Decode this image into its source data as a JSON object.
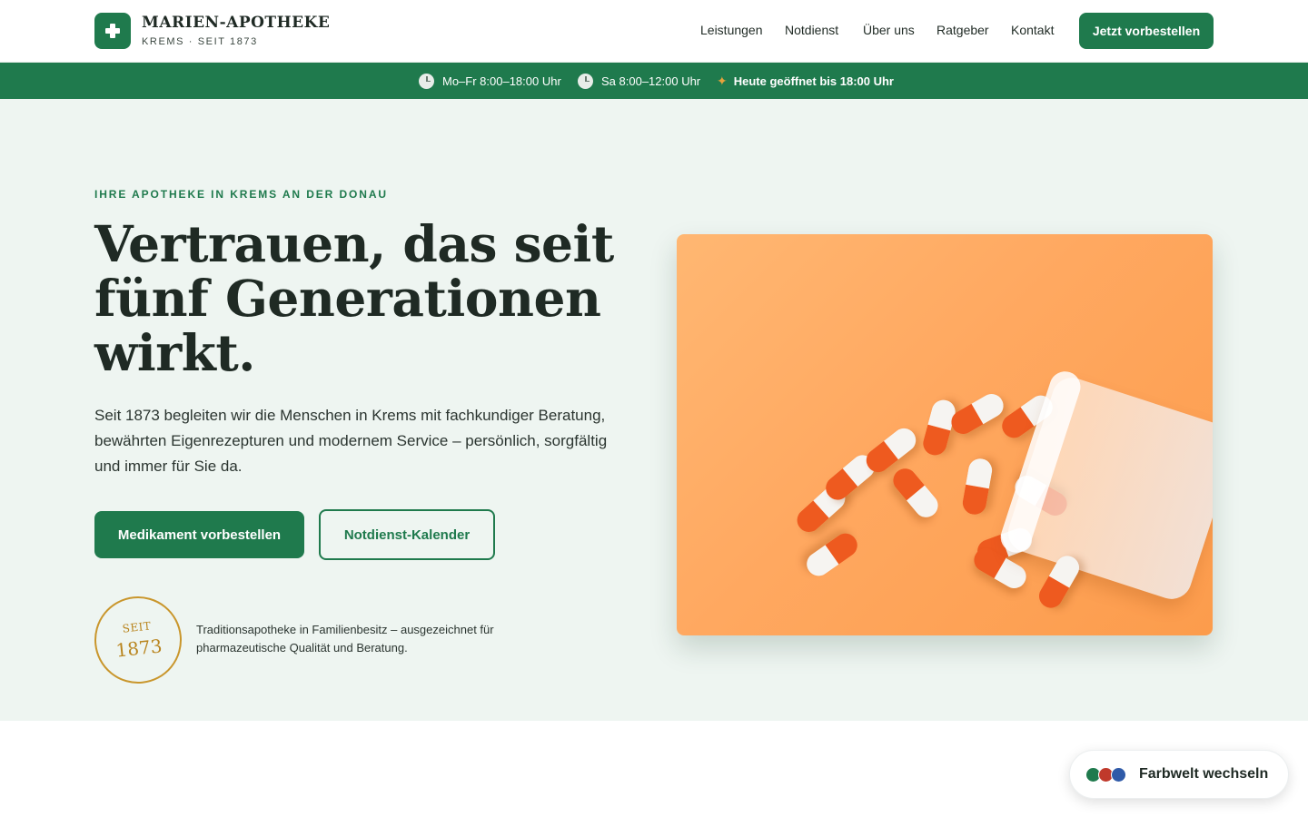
{
  "brand": {
    "name": "MARIEN-APOTHEKE",
    "subtitle": "KREMS · SEIT 1873",
    "logo_icon": "cross-icon"
  },
  "nav": {
    "items": [
      "Leistungen",
      "Notdienst",
      "Über uns",
      "Ratgeber",
      "Kontakt"
    ],
    "cta": "Jetzt vorbestellen"
  },
  "hours": {
    "weekday": "Mo–Fr 8:00–18:00 Uhr",
    "saturday": "Sa 8:00–12:00 Uhr",
    "status": "Heute geöffnet bis 18:00 Uhr"
  },
  "hero": {
    "eyebrow": "IHRE APOTHEKE IN KREMS AN DER DONAU",
    "headline": "Vertrauen, das seit fünf Generationen wirkt.",
    "lead": "Seit 1873 begleiten wir die Menschen in Krems mit fachkundiger Beratung, bewährten Eigenrezepturen und modernem Service – persönlich, sorgfältig und immer für Sie da.",
    "primary_button": "Medikament vorbestellen",
    "secondary_button": "Notdienst-Kalender",
    "seal_top": "SEIT",
    "seal_year": "1873",
    "seal_text": "Traditionsapotheke in Familienbesitz – ausgezeichnet für pharmazeutische Qualität und Beratung."
  },
  "color_switch": {
    "label": "Farbwelt wechseln",
    "colors": [
      "#1f7a4d",
      "#c0392b",
      "#2f5aa8"
    ]
  },
  "theme": {
    "primary": "#1f7a4d",
    "accent_gold": "#c9962c",
    "hero_bg": "#eef5f1"
  }
}
